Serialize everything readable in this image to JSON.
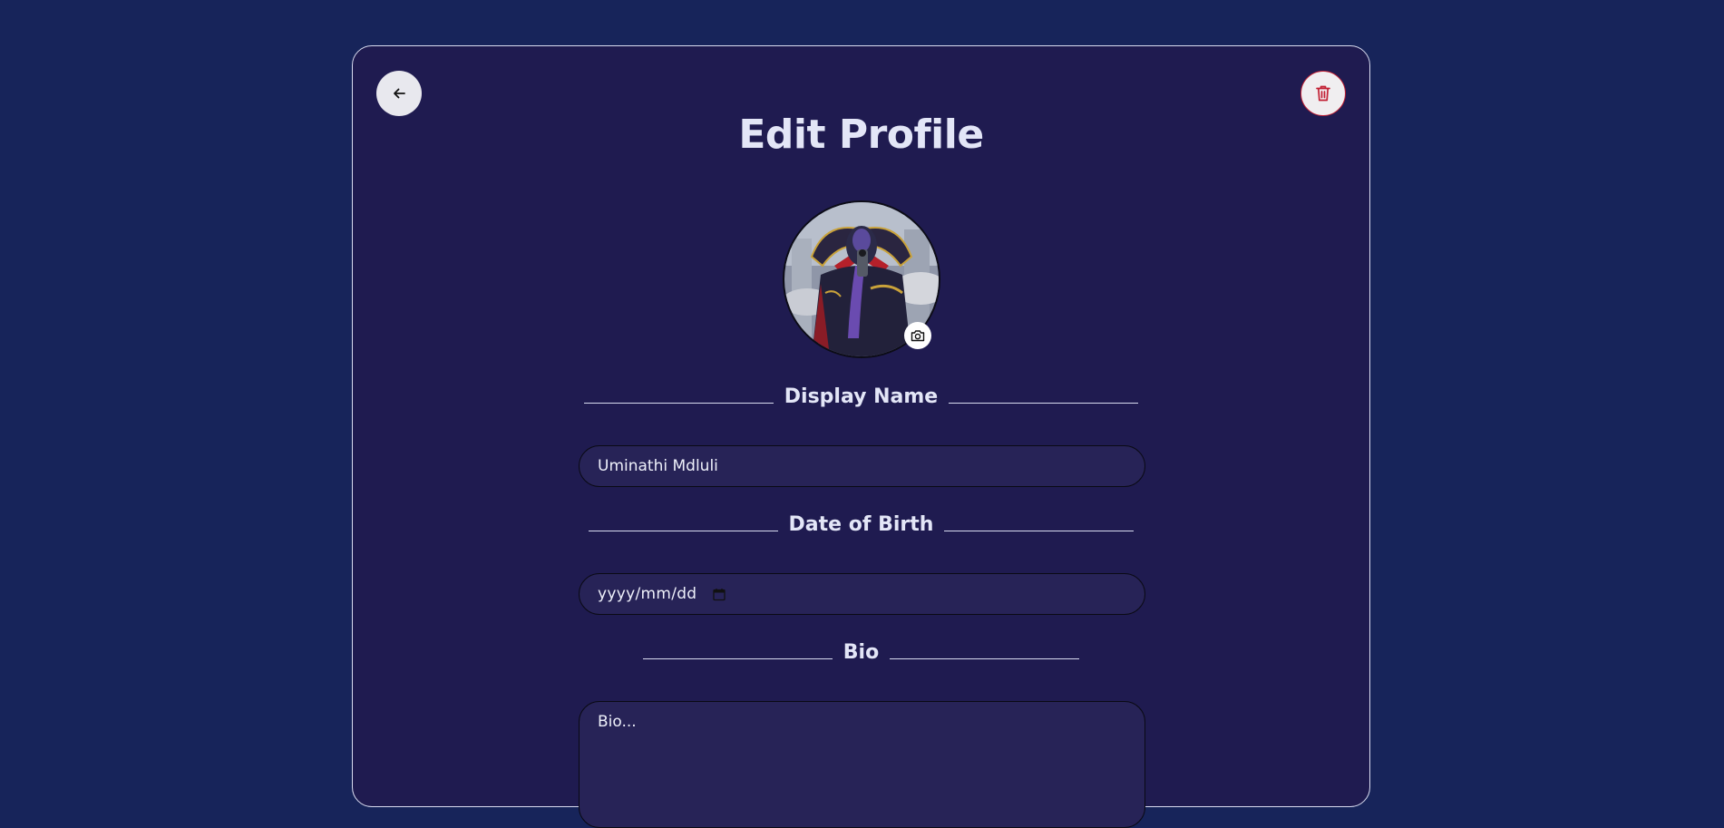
{
  "header": {
    "title": "Edit Profile",
    "back_icon": "arrow-left-icon",
    "delete_icon": "trash-icon"
  },
  "avatar": {
    "alt": "Profile picture",
    "camera_icon": "camera-icon"
  },
  "display_name": {
    "label": "Display Name",
    "value": "Uminathi Mdluli"
  },
  "date_of_birth": {
    "label": "Date of Birth",
    "placeholder": "yyyy/mm/dd",
    "calendar_icon": "calendar-icon"
  },
  "bio": {
    "label": "Bio",
    "placeholder": "Bio..."
  },
  "colors": {
    "page_background": "#17245a",
    "card_background": "#1f1b50",
    "input_background": "#272357",
    "delete_accent": "#c21f33",
    "text": "#e3e6f7"
  }
}
